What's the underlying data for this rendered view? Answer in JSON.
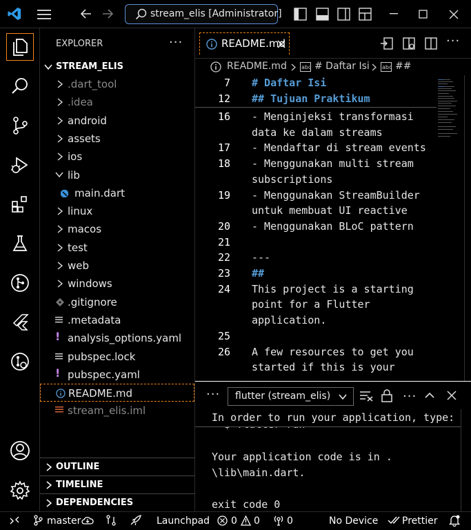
{
  "window": {
    "search": "stream_elis [Administrator]"
  },
  "sidebar": {
    "title": "EXPLORER",
    "more": "···",
    "root": "STREAM_ELIS",
    "items": [
      {
        "label": ".dart_tool",
        "kind": "folder",
        "dim": true
      },
      {
        "label": ".idea",
        "kind": "folder",
        "dim": true
      },
      {
        "label": "android",
        "kind": "folder"
      },
      {
        "label": "assets",
        "kind": "folder"
      },
      {
        "label": "ios",
        "kind": "folder"
      },
      {
        "label": "lib",
        "kind": "folder-open"
      },
      {
        "label": "main.dart",
        "kind": "dart"
      },
      {
        "label": "linux",
        "kind": "folder"
      },
      {
        "label": "macos",
        "kind": "folder"
      },
      {
        "label": "test",
        "kind": "folder"
      },
      {
        "label": "web",
        "kind": "folder"
      },
      {
        "label": "windows",
        "kind": "folder"
      },
      {
        "label": ".gitignore",
        "kind": "gitignore"
      },
      {
        "label": ".metadata",
        "kind": "lines"
      },
      {
        "label": "analysis_options.yaml",
        "kind": "yaml"
      },
      {
        "label": "pubspec.lock",
        "kind": "lines"
      },
      {
        "label": "pubspec.yaml",
        "kind": "yaml"
      },
      {
        "label": "README.md",
        "kind": "info",
        "selected": true
      },
      {
        "label": "stream_elis.iml",
        "kind": "iml",
        "dim": true
      }
    ],
    "sections": [
      "OUTLINE",
      "TIMELINE",
      "DEPENDENCIES"
    ]
  },
  "editor": {
    "tab": "README.md",
    "breadcrumb": {
      "file": "README.md",
      "h1": "# Daftar Isi",
      "h2": "##"
    },
    "sticky": [
      {
        "n": "7",
        "t": "# Daftar Isi"
      },
      {
        "n": "12",
        "t": "## Tujuan Praktikum"
      }
    ],
    "lines": [
      {
        "n": "16",
        "rows": [
          "- Menginjeksi transformasi",
          "data ke dalam streams"
        ]
      },
      {
        "n": "17",
        "rows": [
          "- Mendaftar di stream events"
        ]
      },
      {
        "n": "18",
        "rows": [
          "- Menggunakan multi stream",
          "subscriptions"
        ]
      },
      {
        "n": "19",
        "rows": [
          "- Menggunakan StreamBuilder",
          "untuk membuat UI reactive"
        ]
      },
      {
        "n": "20",
        "rows": [
          "- Menggunakan BLoC pattern"
        ]
      },
      {
        "n": "21",
        "rows": [
          ""
        ]
      },
      {
        "n": "22",
        "rows": [
          "---"
        ]
      },
      {
        "n": "23",
        "rows": [
          "##"
        ],
        "head": true
      },
      {
        "n": "24",
        "rows": [
          "This project is a starting",
          "point for a Flutter",
          "application."
        ]
      },
      {
        "n": "25",
        "rows": [
          ""
        ]
      },
      {
        "n": "26",
        "rows": [
          "A few resources to get you",
          "started if this is your"
        ]
      }
    ]
  },
  "panel": {
    "terminal": "flutter (stream_elis)",
    "sticky_line": "In order to run your application, type:",
    "partial_line": "  $ flutter run",
    "lines": [
      "Your application code is in .",
      "\\lib\\main.dart.",
      "",
      "exit code 0"
    ]
  },
  "status": {
    "branch": "master",
    "launchpad": "Launchpad",
    "errors": "0",
    "warnings": "0",
    "ports": "0",
    "device": "No Device",
    "prettier": "Prettier"
  },
  "colors": {
    "accent": "#f38518",
    "heading": "#569cd6",
    "vscode_blue": "#2f9be8"
  }
}
